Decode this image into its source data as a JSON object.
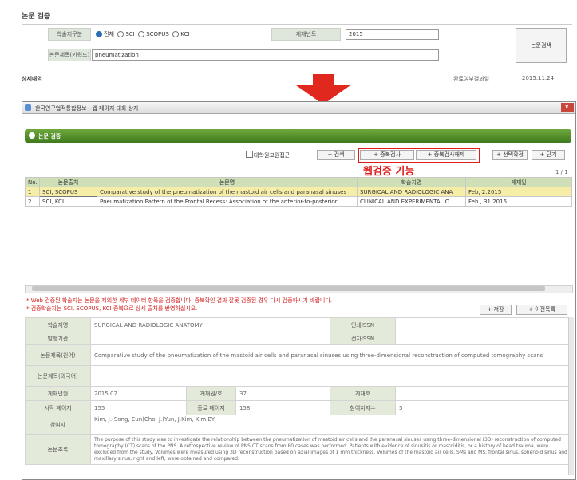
{
  "search": {
    "title": "논문 검증",
    "journal_type_label": "학술지구분",
    "journal_options": [
      "전체",
      "SCI",
      "SCOPUS",
      "KCI"
    ],
    "year_label": "게재년도",
    "year_value": "2015",
    "keyword_label": "논문제목(키워드)",
    "keyword_value": "pneumatization",
    "search_button": "논문검색",
    "detail_label": "상세내역",
    "right_status": "완료여부결과일",
    "right_date": "2015.11.24"
  },
  "window": {
    "title": "한국연구업적통합정보 - 웹 페이지 대화 상자",
    "panel_title": "논문 검증",
    "toolbar": {
      "checkbox_label": "대학원교원접근",
      "btn_search": "+ 검색",
      "btn_dup_check": "+ 중복검사",
      "btn_dup_cancel": "+ 중복검사해제",
      "btn_select": "+ 선택확정",
      "btn_close": "+ 닫기"
    },
    "annotation": "웹검증 기능",
    "page_info": "1 / 1",
    "table": {
      "headers": [
        "No.",
        "논문출처",
        "논문명",
        "학술지명",
        "게재일"
      ],
      "rows": [
        [
          "1",
          "SCI, SCOPUS",
          "Comparative study of the pneumatization of the mastoid air cells and paranasal sinuses",
          "SURGICAL AND RADIOLOGIC ANA",
          "Feb, 2.2015"
        ],
        [
          "2",
          "SCI, KCI",
          "Pneumatization Pattern of the Frontal Recess: Association of the anterior-to-posterior",
          "CLINICAL AND EXPERIMENTAL O",
          "Feb., 31.2016"
        ]
      ]
    },
    "notes": [
      "* Web 검증된 학술지는 논문을 제외한 세부 데이터 항목을 검증합니다. 중복확인 결과 잘못 검증된 경우 다시 검증하시기 바랍니다.",
      "* 검증학술지는 SCI, SCOPUS, KCI 중복으로 상세 출처를 반영하십시오."
    ],
    "bottom_buttons": [
      "+ 저장",
      "+ 이전목록"
    ],
    "detail": {
      "journal_name_label": "학술지명",
      "journal_name_value": "SURGICAL AND RADIOLOGIC ANATOMY",
      "issn_label": "인쇄ISSN",
      "issn_value": "",
      "publisher_label": "발행기관",
      "eissn_label": "전자ISSN",
      "title_label": "논문제목(원어)",
      "title_value": "Comparative study of the pneumatization of the mastoid air cells and paranasal sinuses using three-dimensional reconstruction of computed tomography scans",
      "title_other_label": "논문제목(외국어)",
      "year_label": "게재년월",
      "year_value": "2015.02",
      "vol_label": "게재권/호",
      "vol_value": "37",
      "num_label": "게재호",
      "page_start_label": "시작 페이지",
      "page_start_value": "155",
      "page_end_label": "종료 페이지",
      "page_end_value": "158",
      "authors_count_label": "참여저자수",
      "authors_count_value": "5",
      "authors_label": "참여자",
      "authors_value": "Kim, J.(Song, Eun)Cho, J.(Yun, J.Kim, Kim BY",
      "abstract_label": "논문초록",
      "abstract_value": "The purpose of this study was to investigate the relationship between the pneumatization of mastoid air cells and the paranasal sinuses using three-dimensional (3D) reconstruction of computed tomography (CT) scans of the PNS. A retrospective review of PNS CT scans from 80 cases was performed. Patients with evidence of sinusitis or mastoiditis, or a history of head trauma, were excluded from the study. Volumes were measured using 3D reconstruction based on axial images of 1 mm thickness. Volumes of the mastoid air cells, SMs and MS, frontal sinus, sphenoid sinus and maxillary sinus, right and left, were obtained and compared."
    }
  }
}
